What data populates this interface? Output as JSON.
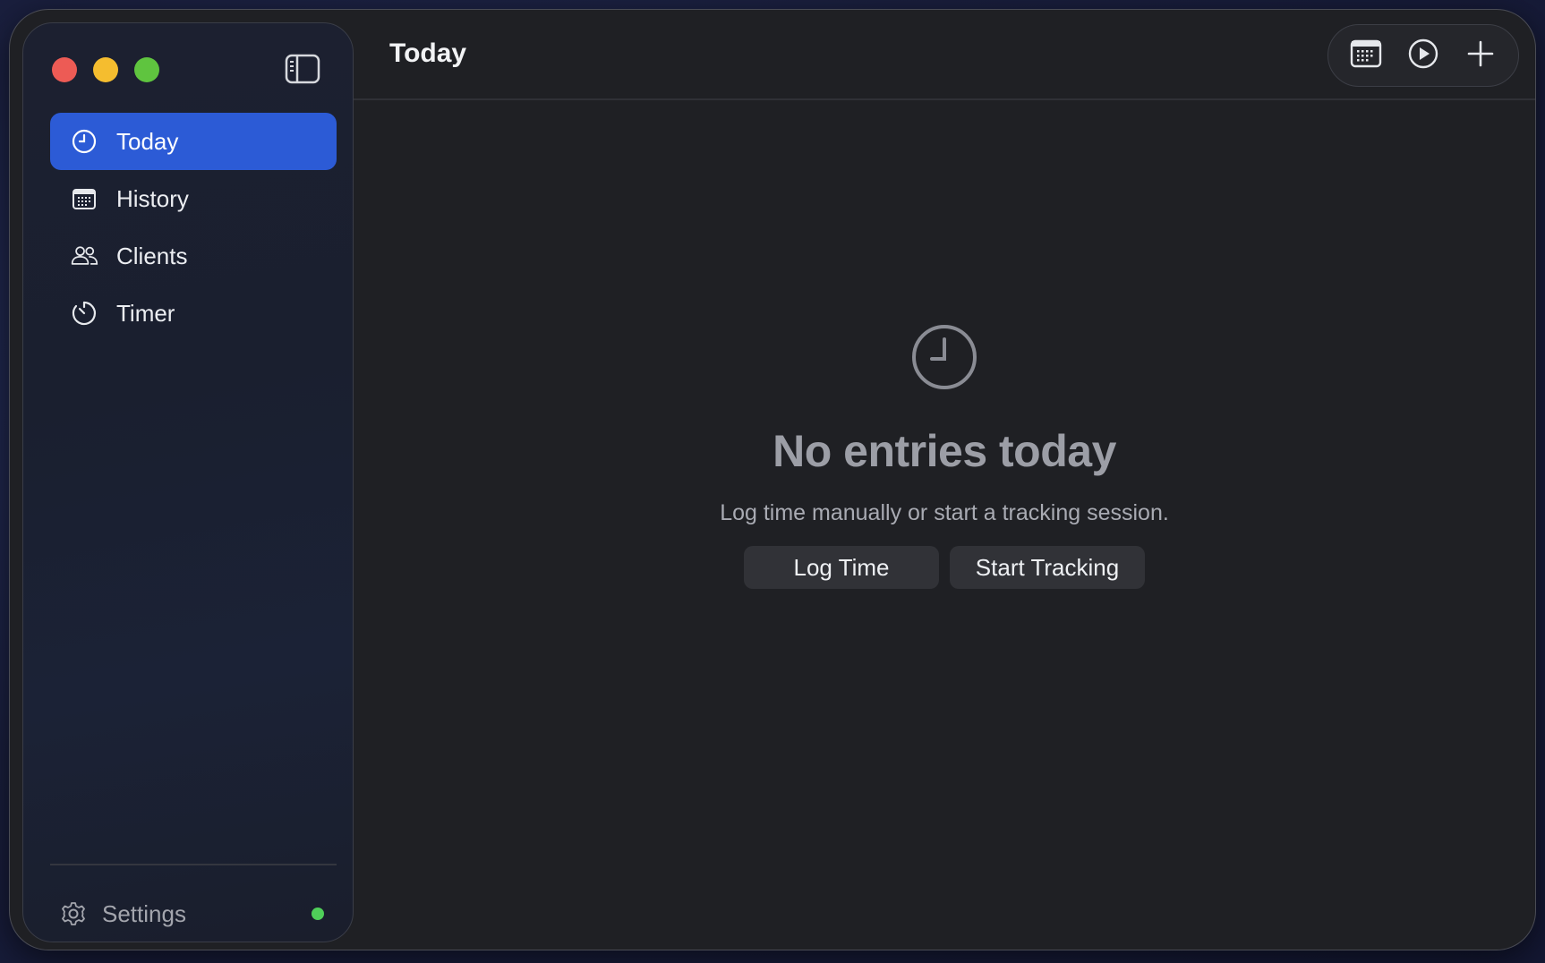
{
  "window": {
    "controls": [
      "close",
      "minimize",
      "zoom"
    ]
  },
  "sidebar": {
    "items": [
      {
        "label": "Today",
        "icon": "clock-icon",
        "active": true
      },
      {
        "label": "History",
        "icon": "calendar-icon",
        "active": false
      },
      {
        "label": "Clients",
        "icon": "people-icon",
        "active": false
      },
      {
        "label": "Timer",
        "icon": "timer-icon",
        "active": false
      }
    ],
    "settings": {
      "label": "Settings",
      "icon": "gear-icon",
      "status_color": "#4fcf59"
    }
  },
  "header": {
    "title": "Today",
    "toolbar": [
      "calendar-icon",
      "play-icon",
      "plus-icon"
    ]
  },
  "empty_state": {
    "icon": "clock-icon",
    "title": "No entries today",
    "subtitle": "Log time manually or start a tracking session.",
    "actions": {
      "log_time": "Log Time",
      "start_tracking": "Start Tracking"
    }
  },
  "colors": {
    "accent": "#2c5bd6",
    "background": "#1f2024"
  }
}
